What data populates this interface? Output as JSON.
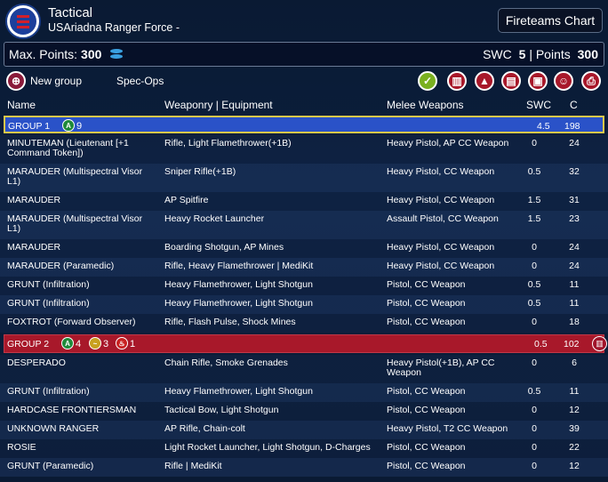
{
  "header": {
    "title": "Tactical",
    "subtitle": "USAriadna Ranger Force -",
    "fireteams_label": "Fireteams Chart"
  },
  "points": {
    "max_label": "Max. Points:",
    "max_value": "300",
    "swc_label": "SWC",
    "swc_value": "5",
    "points_label": "| Points",
    "points_value": "300"
  },
  "toolbar": {
    "new_group_label": "New group",
    "spec_ops_label": "Spec-Ops"
  },
  "columns": {
    "name": "Name",
    "weaponry": "Weaponry | Equipment",
    "melee": "Melee Weapons",
    "swc": "SWC",
    "c": "C"
  },
  "colors": {
    "group1": "#2a52c8",
    "group2": "#a8182a",
    "accent": "#3aa0e0"
  },
  "group1": {
    "label": "GROUP 1",
    "regular": "9",
    "swc": "4.5",
    "c": "198",
    "units": [
      {
        "name": "MINUTEMAN (Lieutenant [+1 Command Token])",
        "weapons": "Rifle, Light Flamethrower(+1B)",
        "melee": "Heavy Pistol, AP CC Weapon",
        "swc": "0",
        "c": "24"
      },
      {
        "name": "MARAUDER (Multispectral Visor L1)",
        "weapons": "Sniper Rifle(+1B)",
        "melee": "Heavy Pistol, CC Weapon",
        "swc": "0.5",
        "c": "32"
      },
      {
        "name": "MARAUDER",
        "weapons": "AP Spitfire",
        "melee": "Heavy Pistol, CC Weapon",
        "swc": "1.5",
        "c": "31"
      },
      {
        "name": "MARAUDER (Multispectral Visor L1)",
        "weapons": "Heavy Rocket Launcher",
        "melee": "Assault Pistol, CC Weapon",
        "swc": "1.5",
        "c": "23"
      },
      {
        "name": "MARAUDER",
        "weapons": "Boarding Shotgun, AP Mines",
        "melee": "Heavy Pistol, CC Weapon",
        "swc": "0",
        "c": "24"
      },
      {
        "name": "MARAUDER (Paramedic)",
        "weapons": "Rifle, Heavy Flamethrower | MediKit",
        "melee": "Heavy Pistol, CC Weapon",
        "swc": "0",
        "c": "24"
      },
      {
        "name": "GRUNT (Infiltration)",
        "weapons": "Heavy Flamethrower, Light Shotgun",
        "melee": "Pistol, CC Weapon",
        "swc": "0.5",
        "c": "11"
      },
      {
        "name": "GRUNT (Infiltration)",
        "weapons": "Heavy Flamethrower, Light Shotgun",
        "melee": "Pistol, CC Weapon",
        "swc": "0.5",
        "c": "11"
      },
      {
        "name": "FOXTROT (Forward Observer)",
        "weapons": "Rifle, Flash Pulse, Shock Mines",
        "melee": "Pistol, CC Weapon",
        "swc": "0",
        "c": "18"
      }
    ]
  },
  "group2": {
    "label": "GROUP 2",
    "regular": "4",
    "irregular": "3",
    "impetuous": "1",
    "swc": "0.5",
    "c": "102",
    "units": [
      {
        "name": "DESPERADO",
        "weapons": "Chain Rifle, Smoke Grenades",
        "melee": "Heavy Pistol(+1B), AP CC Weapon",
        "swc": "0",
        "c": "6"
      },
      {
        "name": "GRUNT (Infiltration)",
        "weapons": "Heavy Flamethrower, Light Shotgun",
        "melee": "Pistol, CC Weapon",
        "swc": "0.5",
        "c": "11"
      },
      {
        "name": "HARDCASE FRONTIERSMAN",
        "weapons": "Tactical Bow, Light Shotgun",
        "melee": "Pistol, CC Weapon",
        "swc": "0",
        "c": "12"
      },
      {
        "name": "UNKNOWN RANGER",
        "weapons": "AP Rifle, Chain-colt",
        "melee": "Heavy Pistol, T2 CC Weapon",
        "swc": "0",
        "c": "39"
      },
      {
        "name": "ROSIE",
        "weapons": "Light Rocket Launcher, Light Shotgun, D-Charges",
        "melee": "Pistol, CC Weapon",
        "swc": "0",
        "c": "22"
      },
      {
        "name": "GRUNT (Paramedic)",
        "weapons": "Rifle | MediKit",
        "melee": "Pistol, CC Weapon",
        "swc": "0",
        "c": "12"
      }
    ]
  }
}
